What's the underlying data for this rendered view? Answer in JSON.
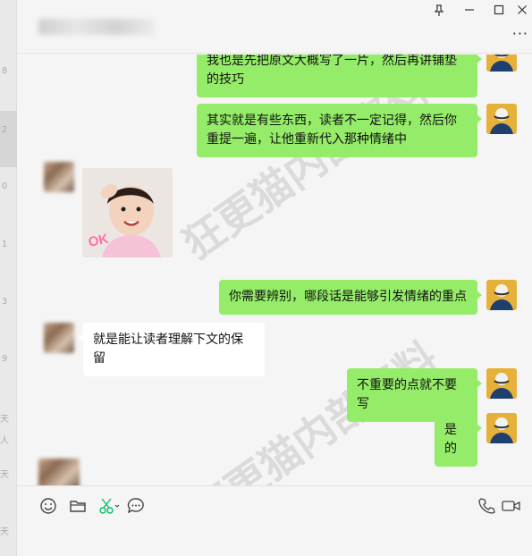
{
  "chat": {
    "title": "",
    "window_controls": [
      "pin-icon",
      "minimize-icon",
      "maximize-icon",
      "close-icon"
    ],
    "more_label": "···"
  },
  "sidebar": {
    "partial_labels": [
      "8",
      "2",
      "0",
      "1",
      "3",
      "9",
      "天",
      "人",
      "天",
      "天"
    ]
  },
  "messages": [
    {
      "from": "me",
      "type": "text",
      "text": "我也是先把原文大概写了一片，然后再讲铺垫的技巧"
    },
    {
      "from": "me",
      "type": "text",
      "text": "其实就是有些东西，读者不一定记得，然后你重提一遍，让他重新代入那种情绪中"
    },
    {
      "from": "other",
      "type": "image",
      "alt": "child-photo",
      "badge": "OK"
    },
    {
      "from": "me",
      "type": "text",
      "text": "你需要辨别，哪段话是能够引发情绪的重点"
    },
    {
      "from": "other",
      "type": "text",
      "text": "就是能让读者理解下文的保留"
    },
    {
      "from": "me",
      "type": "text",
      "text": "不重要的点就不要写"
    },
    {
      "from": "me",
      "type": "text",
      "text": "是的"
    }
  ],
  "toolbar": {
    "left_icons": [
      "emoji-icon",
      "folder-icon",
      "scissors-icon",
      "chat-history-icon"
    ],
    "right_icons": [
      "phone-icon",
      "video-icon"
    ],
    "accent_color": "#07c160"
  },
  "colors": {
    "bubble_mine": "#95ec69",
    "bubble_other": "#ffffff",
    "background": "#f5f5f5"
  },
  "watermark": "狂更猫内部资料"
}
